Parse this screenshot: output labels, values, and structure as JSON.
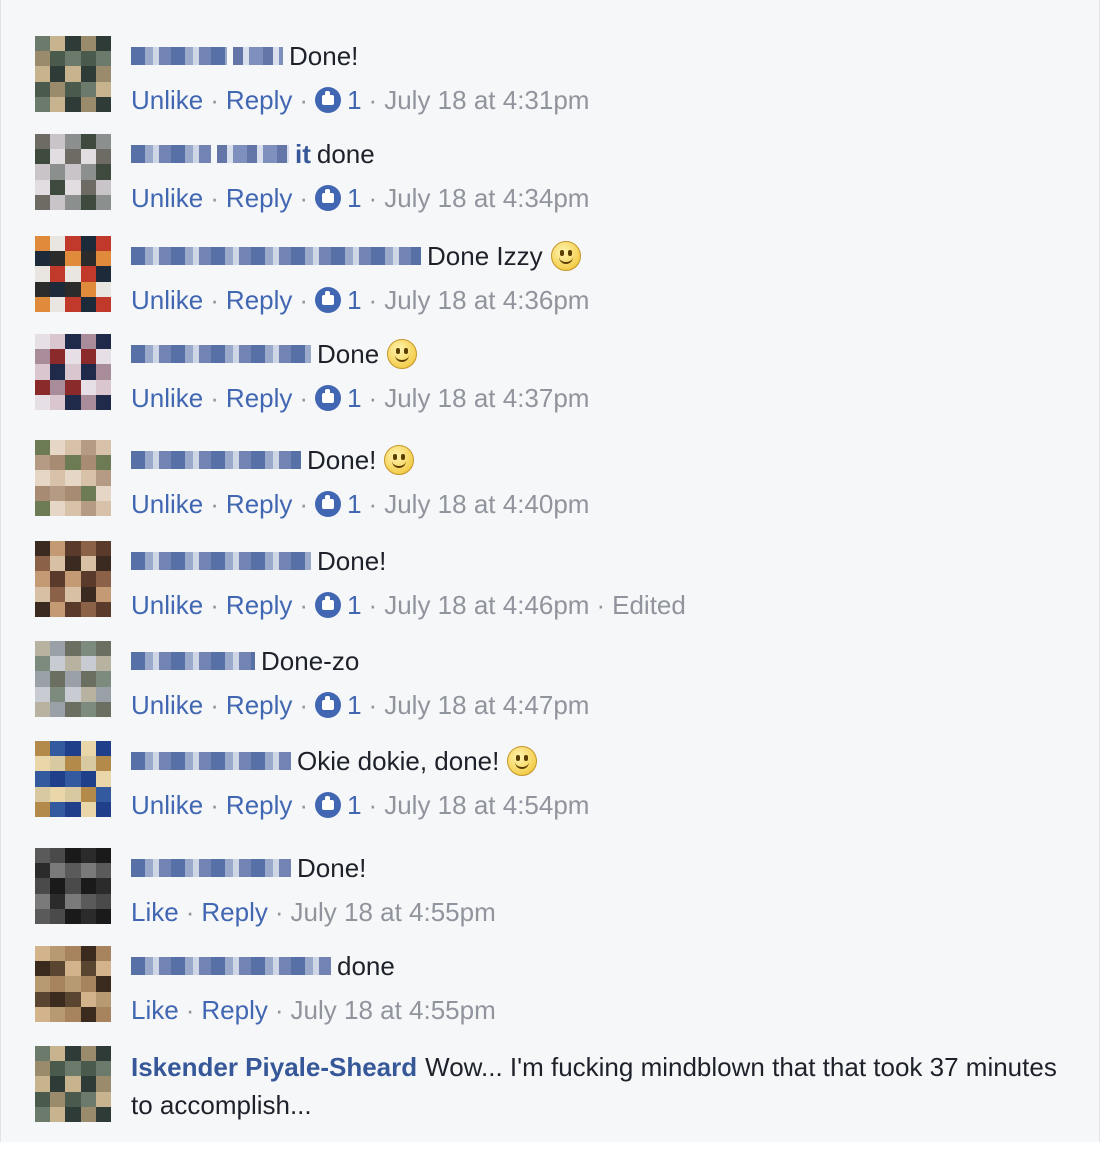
{
  "comments": [
    {
      "text": "Done!",
      "author_tail": "",
      "smiley": false,
      "action": "Unlike",
      "reply": "Reply",
      "likes": "1",
      "time": "July 18 at 4:31pm",
      "edited": ""
    },
    {
      "text": "done",
      "author_tail": "it",
      "smiley": false,
      "action": "Unlike",
      "reply": "Reply",
      "likes": "1",
      "time": "July 18 at 4:34pm",
      "edited": ""
    },
    {
      "text": "Done Izzy",
      "author_tail": "",
      "smiley": true,
      "action": "Unlike",
      "reply": "Reply",
      "likes": "1",
      "time": "July 18 at 4:36pm",
      "edited": ""
    },
    {
      "text": "Done",
      "author_tail": "",
      "smiley": true,
      "action": "Unlike",
      "reply": "Reply",
      "likes": "1",
      "time": "July 18 at 4:37pm",
      "edited": ""
    },
    {
      "text": "Done!",
      "author_tail": "",
      "smiley": true,
      "action": "Unlike",
      "reply": "Reply",
      "likes": "1",
      "time": "July 18 at 4:40pm",
      "edited": ""
    },
    {
      "text": "Done!",
      "author_tail": "",
      "smiley": false,
      "action": "Unlike",
      "reply": "Reply",
      "likes": "1",
      "time": "July 18 at 4:46pm",
      "edited": "Edited"
    },
    {
      "text": "Done-zo",
      "author_tail": "",
      "smiley": false,
      "action": "Unlike",
      "reply": "Reply",
      "likes": "1",
      "time": "July 18 at 4:47pm",
      "edited": ""
    },
    {
      "text": "Okie dokie, done!",
      "author_tail": "",
      "smiley": true,
      "action": "Unlike",
      "reply": "Reply",
      "likes": "1",
      "time": "July 18 at 4:54pm",
      "edited": ""
    },
    {
      "text": "Done!",
      "author_tail": "",
      "smiley": false,
      "action": "Like",
      "reply": "Reply",
      "likes": "",
      "time": "July 18 at 4:55pm",
      "edited": ""
    },
    {
      "text": "done",
      "author_tail": "",
      "smiley": false,
      "action": "Like",
      "reply": "Reply",
      "likes": "",
      "time": "July 18 at 4:55pm",
      "edited": ""
    }
  ],
  "last_comment": {
    "author": "Iskender Piyale-Sheard",
    "text": "Wow... I'm fucking mindblown that that took 37 minutes to accomplish..."
  },
  "colors": {
    "link": "#4267b2",
    "author": "#365899",
    "meta": "#90949c",
    "text": "#1d2129",
    "background": "#f6f7f9"
  },
  "icons": {
    "like": "thumbs-up-icon",
    "emoji": "smiley-icon"
  }
}
